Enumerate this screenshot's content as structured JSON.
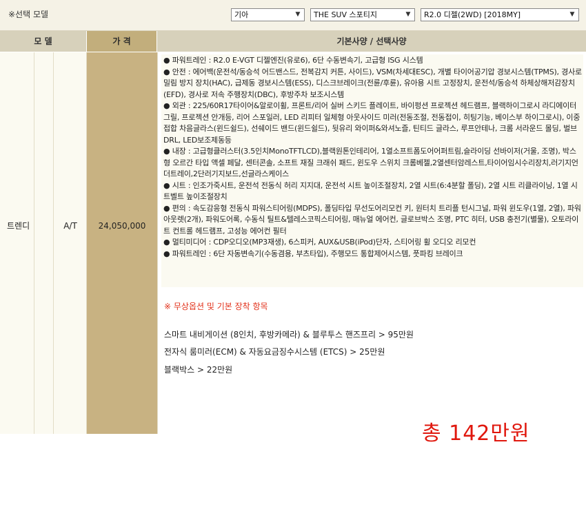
{
  "header": {
    "title": "※선택 모델",
    "selects": [
      {
        "value": "기아"
      },
      {
        "value": "THE SUV 스포티지"
      },
      {
        "value": "R2.0 디젤(2WD) [2018MY]"
      }
    ]
  },
  "table": {
    "columns": [
      "모 델",
      "가 격",
      "기본사양 / 선택사양"
    ],
    "row": {
      "trim": "트렌디",
      "transmission": "A/T",
      "price": "24,050,000",
      "specs": [
        "● 파워트레인 : R2.0 E-VGT 디젤엔진(유로6), 6단 수동변속기, 고급형 ISG 시스템",
        "● 안전 : 에어백(운전석/동승석 어드밴스드, 전복감지 커튼, 사이드), VSM(차세대ESC), 개별 타이어공기압 경보시스템(TPMS), 경사로 밀림 방지 장치(HAC), 급제동 경보시스템(ESS), 디스크브레이크(전륜/후륜), 유아용 시트 고정장치, 운전석/동승석 하체상해저감장치(EFD), 경사로 저속 주행장치(DBC), 후방주차 보조시스템",
        "● 외관 : 225/60R17타이어&알로이휠, 프론트/리어 실버 스키드 플레이트, 바이펑션 프로젝션 헤드램프, 블랙하이그로시 라디에이터 그릴, 프로젝션 안개등, 리어 스포일러, LED 리피터 일체형 아웃사이드 미러(전동조절, 전동접이, 히팅기능, 베이스부 하이그로시), 이중접합 차음글라스(윈드쉴드), 선쉐이드 밴드(윈드쉴드), 뒷유리 와이퍼&와셔노즐, 틴티드 글라스, 루프안테나, 크롬 서라운드 몰딩, 벌브 DRL, LED보조제동등",
        "● 내장 : 고급형클러스터(3.5인치MonoTFTLCD),블랙원톤인테리어, 1열소프트폼도어어퍼트림,슬라이딩 선바이저(거울, 조명), 박스형 오르간 타입 액셀 페달, 센터콘솔, 소프트 재질 크래쉬 패드, 윈도우 스위치 크롬베젤,2열센터암레스트,타이어임시수리장치,러기지언더트레이,2단러기지보드,선글라스케이스",
        "● 시트 : 인조가죽시트, 운전석 전동식 허리 지지대, 운전석 시트 높이조절장치, 2열 시트(6:4분할 폴딩), 2열 시트 리클라이닝, 1열 시트벨트 높이조절장치",
        "● 편의 : 속도감응형 전동식 파워스티어링(MDPS), 폴딩타입 무선도어리모컨 키, 원터치 트리플 턴시그널, 파워 윈도우(1열, 2열), 파워 아웃렛(2개), 파워도어록, 수동식 틸트&텔레스코픽스티어링, 매뉴얼 에어컨, 글로브박스 조명, PTC 히터, USB 충전기(별물), 오토라이트 컨트롤 헤드램프, 고성능 에어컨 필터",
        "● 멀티미디어 : CDP오디오(MP3재생), 6스피커, AUX&USB(iPod)단자, 스티어링 휠 오디오 리모컨",
        "● 파워트레인 : 6단 자동변속기(수동겸용, 부츠타입), 주행모드 통합제어시스템, 풋파킹 브레이크"
      ]
    }
  },
  "extras": {
    "title": "※ 무상옵션 및 기본 장착 항목",
    "items": [
      "스마트 내비게이션 (8인치, 후방카메라) & 블루투스 핸즈프리 > 95만원",
      "전자식 룸미러(ECM) & 자동요금징수시스템 (ETCS) > 25만원",
      "블랙박스 > 22만원"
    ],
    "total": "총  142만원"
  },
  "colors": {
    "header_bg": "#d7d1bb",
    "price_col": "#c8b282",
    "accent_red": "#e0170d"
  },
  "icons": {
    "dropdown": "chevron-down-icon"
  }
}
